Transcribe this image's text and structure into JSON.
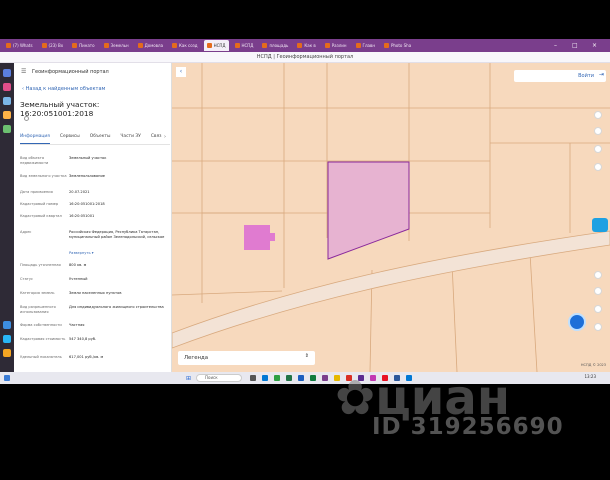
{
  "browser": {
    "tabs": [
      {
        "label": "(7) Whats",
        "active": false
      },
      {
        "label": "(23) Вх",
        "active": false
      },
      {
        "label": "Пинато",
        "active": false
      },
      {
        "label": "Земельн",
        "active": false
      },
      {
        "label": "Домовла",
        "active": false
      },
      {
        "label": "Как созд",
        "active": false
      },
      {
        "label": "НСПД",
        "active": true
      },
      {
        "label": "НСПД",
        "active": false
      },
      {
        "label": "площадь",
        "active": false
      },
      {
        "label": "Как в",
        "active": false
      },
      {
        "label": "Разлин",
        "active": false
      },
      {
        "label": "Главн",
        "active": false
      },
      {
        "label": "Photo Sha",
        "active": false
      }
    ],
    "page_title": "НСПД | Геоинформационный портал"
  },
  "panel": {
    "header": "Геоинформационный портал",
    "back_link": "Назад к найденным объектам",
    "title": "Земельный участок: 16:20:051001:2018",
    "tabs": [
      "Информация",
      "Сервисы",
      "Объекты",
      "Части ЗУ",
      "Связ"
    ],
    "rows": [
      {
        "k": "Вид объекта недвижимости",
        "v": "Земельный участок"
      },
      {
        "k": "Вид земельного участка",
        "v": "Землепользование"
      },
      {
        "k": "Дата присвоения",
        "v": "20.07.2021"
      },
      {
        "k": "Кадастровый номер",
        "v": "16:20:051001:2018"
      },
      {
        "k": "Кадастровый квартал",
        "v": "16:20:051001"
      },
      {
        "k": "Адрес",
        "v": "Российская Федерация, Республика Татарстан, муниципальный район Зеленодольский, сельское"
      },
      {
        "k": "",
        "v": "Развернуть ▾",
        "link": true
      },
      {
        "k": "Площадь уточненная",
        "v": "800 кв. м"
      },
      {
        "k": "Статус",
        "v": "Учтенный"
      },
      {
        "k": "Категория земель",
        "v": "Земли населенных пунктов"
      },
      {
        "k": "Вид разрешенного использования",
        "v": "Для индивидуального жилищного строительства"
      },
      {
        "k": "Форма собственности",
        "v": "Частная"
      },
      {
        "k": "Кадастровая стоимость",
        "v": "547 340,8 руб."
      },
      {
        "k": "Удельный показатель",
        "v": "617,001 руб./кв. м"
      }
    ]
  },
  "map": {
    "legend_label": "Легенда",
    "login_label": "Войти",
    "scale_text": "НСПД © 2023",
    "colors": {
      "background": "#f7d9bd",
      "parcel_lines": "#d8a97e",
      "selected_fill": "#e7b3d1",
      "selected_stroke": "#8a2a9c",
      "pink_parcel": "#e07bd0",
      "road": "#f3e3d6"
    }
  },
  "taskbar": {
    "search_placeholder": "Поиск",
    "clock": "13:23"
  },
  "watermark": {
    "logo": "циан",
    "id_text": "ID 319256690"
  }
}
